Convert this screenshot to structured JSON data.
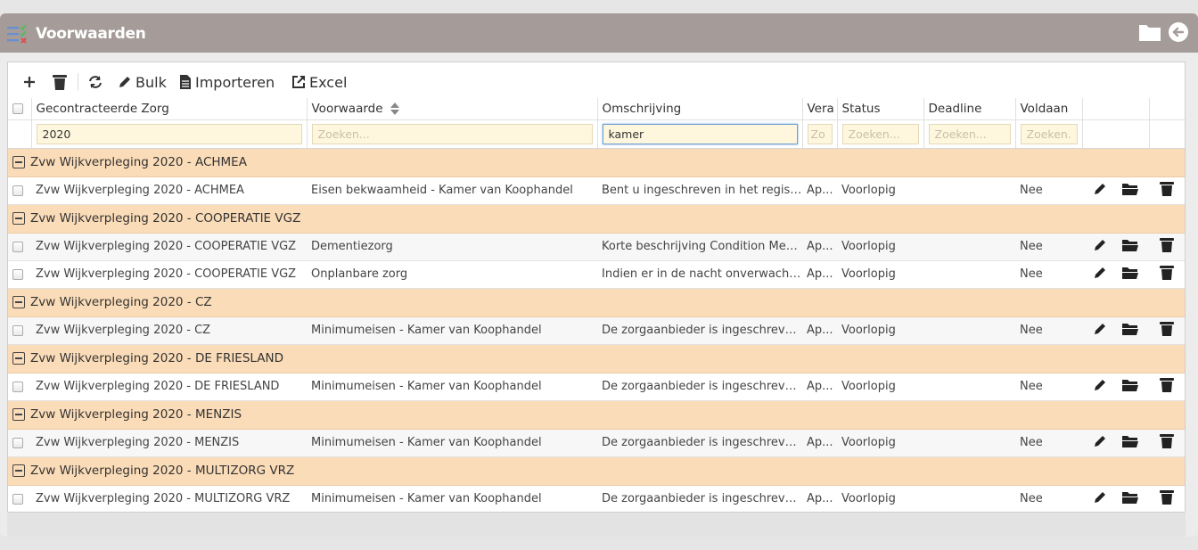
{
  "window": {
    "title": "Voorwaarden"
  },
  "toolbar": {
    "add_label": "",
    "delete_label": "",
    "refresh_label": "",
    "bulk_label": "Bulk",
    "import_label": "Importeren",
    "excel_label": "Excel"
  },
  "columns": {
    "gecontracteerde_zorg": "Gecontracteerde Zorg",
    "voorwaarde": "Voorwaarde",
    "omschrijving": "Omschrijving",
    "vera": "Vera",
    "status": "Status",
    "deadline": "Deadline",
    "voldaan": "Voldaan"
  },
  "filters": {
    "gecontracteerde_zorg_value": "2020",
    "voorwaarde_placeholder": "Zoeken...",
    "omschrijving_value": "kamer",
    "vera_placeholder": "Zo",
    "status_placeholder": "Zoeken...",
    "deadline_placeholder": "Zoeken...",
    "voldaan_placeholder": "Zoeken..."
  },
  "groups": [
    {
      "name": "Zvw Wijkverpleging 2020 - ACHMEA",
      "rows": [
        {
          "zorg": "Zvw Wijkverpleging 2020 - ACHMEA",
          "voorwaarde": "Eisen bekwaamheid - Kamer van Koophandel",
          "omschrijving": "Bent u ingeschreven in het registe...",
          "vera": "Ap...",
          "status": "Voorlopig",
          "deadline": "",
          "voldaan": "Nee"
        }
      ]
    },
    {
      "name": "Zvw Wijkverpleging 2020 - COOPERATIE VGZ",
      "rows": [
        {
          "zorg": "Zvw Wijkverpleging 2020 - COOPERATIE VGZ",
          "voorwaarde": "Dementiezorg",
          "omschrijving": "Korte beschrijving Condition Mem...",
          "vera": "Ap...",
          "status": "Voorlopig",
          "deadline": "",
          "voldaan": "Nee"
        },
        {
          "zorg": "Zvw Wijkverpleging 2020 - COOPERATIE VGZ",
          "voorwaarde": "Onplanbare zorg",
          "omschrijving": "Indien er in de nacht onverwachte ...",
          "vera": "Ap...",
          "status": "Voorlopig",
          "deadline": "",
          "voldaan": "Nee"
        }
      ]
    },
    {
      "name": "Zvw Wijkverpleging 2020 - CZ",
      "rows": [
        {
          "zorg": "Zvw Wijkverpleging 2020 - CZ",
          "voorwaarde": "Minimumeisen - Kamer van Koophandel",
          "omschrijving": "De zorgaanbieder is ingeschreven ...",
          "vera": "Ap...",
          "status": "Voorlopig",
          "deadline": "",
          "voldaan": "Nee"
        }
      ]
    },
    {
      "name": "Zvw Wijkverpleging 2020 - DE FRIESLAND",
      "rows": [
        {
          "zorg": "Zvw Wijkverpleging 2020 - DE FRIESLAND",
          "voorwaarde": "Minimumeisen - Kamer van Koophandel",
          "omschrijving": "De zorgaanbieder is ingeschreven ...",
          "vera": "Ap...",
          "status": "Voorlopig",
          "deadline": "",
          "voldaan": "Nee"
        }
      ]
    },
    {
      "name": "Zvw Wijkverpleging 2020 - MENZIS",
      "rows": [
        {
          "zorg": "Zvw Wijkverpleging 2020 - MENZIS",
          "voorwaarde": "Minimumeisen - Kamer van Koophandel",
          "omschrijving": "De zorgaanbieder is ingeschreven ...",
          "vera": "Ap...",
          "status": "Voorlopig",
          "deadline": "",
          "voldaan": "Nee"
        }
      ]
    },
    {
      "name": "Zvw Wijkverpleging 2020 - MULTIZORG VRZ",
      "rows": [
        {
          "zorg": "Zvw Wijkverpleging 2020 - MULTIZORG VRZ",
          "voorwaarde": "Minimumeisen - Kamer van Koophandel",
          "omschrijving": "De zorgaanbieder is ingeschreven ...",
          "vera": "Ap...",
          "status": "Voorlopig",
          "deadline": "",
          "voldaan": "Nee"
        }
      ]
    }
  ],
  "icons": {
    "app": "checklist-icon",
    "header_folder": "folder-icon",
    "header_back": "back-arrow-icon",
    "row_edit": "pencil-icon",
    "row_open": "folder-open-icon",
    "row_delete": "trash-icon"
  },
  "colors": {
    "titlebar": "#a59c99",
    "group_row": "#fbdcb8",
    "filter_input": "#fef7dd",
    "active_input_border": "#6fa0d4"
  }
}
